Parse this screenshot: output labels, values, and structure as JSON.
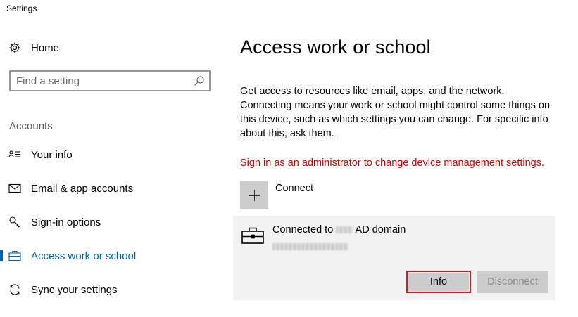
{
  "window": {
    "title": "Settings"
  },
  "nav": {
    "home": {
      "label": "Home",
      "icon": "gear-icon"
    },
    "search": {
      "placeholder": "Find a setting",
      "value": ""
    },
    "section": "Accounts",
    "items": [
      {
        "label": "Your info",
        "icon": "person-card-icon",
        "selected": false
      },
      {
        "label": "Email & app accounts",
        "icon": "mail-icon",
        "selected": false
      },
      {
        "label": "Sign-in options",
        "icon": "key-icon",
        "selected": false
      },
      {
        "label": "Access work or school",
        "icon": "briefcase-icon",
        "selected": true
      },
      {
        "label": "Sync your settings",
        "icon": "sync-icon",
        "selected": false
      }
    ]
  },
  "main": {
    "title": "Access work or school",
    "description": "Get access to resources like email, apps, and the network. Connecting means your work or school might control some things on this device, such as which settings you can change. For specific info about this, ask them.",
    "admin_link": "Sign in as an administrator to change device management settings.",
    "connect_label": "Connect",
    "account": {
      "title_prefix": "Connected to",
      "title_suffix": "AD domain",
      "info_label": "Info",
      "disconnect_label": "Disconnect"
    }
  },
  "colors": {
    "accent": "#0063b1",
    "admin_link": "#c50500",
    "highlight_border": "#cc1f24"
  }
}
